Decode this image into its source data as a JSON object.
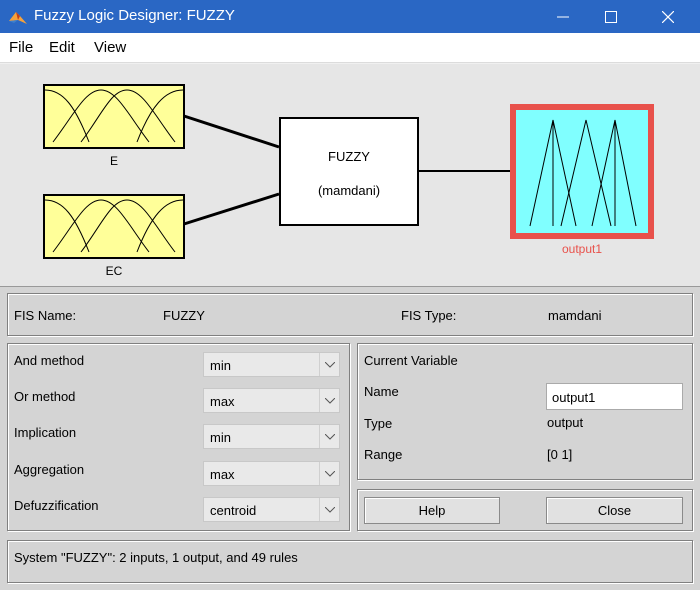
{
  "window": {
    "title": "Fuzzy Logic Designer: FUZZY",
    "minimize_icon": "minimize-icon",
    "maximize_icon": "maximize-icon",
    "close_icon": "close-icon"
  },
  "menu": [
    "File",
    "Edit",
    "View"
  ],
  "diagram": {
    "inputs": [
      "E",
      "EC"
    ],
    "system_name": "FUZZY",
    "system_type": "(mamdani)",
    "output": "output1",
    "selected_color": "#e8514b",
    "input_color": "#ffff99",
    "output_color": "#80ffff"
  },
  "fis": {
    "name_label": "FIS Name:",
    "name_value": "FUZZY",
    "type_label": "FIS Type:",
    "type_value": "mamdani"
  },
  "methods": [
    {
      "label": "And method",
      "value": "min"
    },
    {
      "label": "Or method",
      "value": "max"
    },
    {
      "label": "Implication",
      "value": "min"
    },
    {
      "label": "Aggregation",
      "value": "max"
    },
    {
      "label": "Defuzzification",
      "value": "centroid"
    }
  ],
  "current_variable": {
    "heading": "Current Variable",
    "name_label": "Name",
    "name_value": "output1",
    "type_label": "Type",
    "type_value": "output",
    "range_label": "Range",
    "range_value": "[0 1]"
  },
  "buttons": {
    "help": "Help",
    "close": "Close"
  },
  "status": "System \"FUZZY\": 2 inputs, 1 output, and 49 rules"
}
